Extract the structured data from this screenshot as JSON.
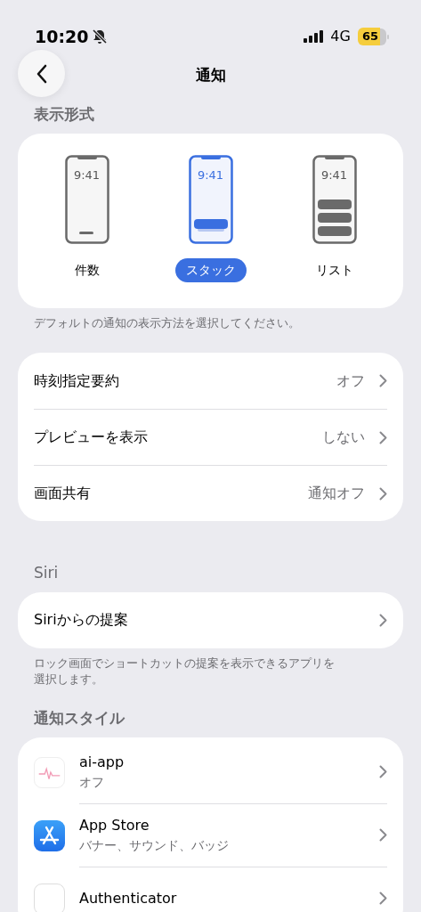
{
  "status_bar": {
    "time": "10:20",
    "network": "4G",
    "battery": "65"
  },
  "nav": {
    "title": "通知"
  },
  "display_style": {
    "header": "表示形式",
    "options": [
      {
        "label": "件数",
        "kind": "count",
        "time": "9:41",
        "selected": false
      },
      {
        "label": "スタック",
        "kind": "stack",
        "time": "9:41",
        "selected": true
      },
      {
        "label": "リスト",
        "kind": "list",
        "time": "9:41",
        "selected": false
      }
    ],
    "footer": "デフォルトの通知の表示方法を選択してください。"
  },
  "settings": [
    {
      "label": "時刻指定要約",
      "value": "オフ"
    },
    {
      "label": "プレビューを表示",
      "value": "しない"
    },
    {
      "label": "画面共有",
      "value": "通知オフ"
    }
  ],
  "siri": {
    "header": "Siri",
    "rows": [
      {
        "label": "Siriからの提案"
      }
    ],
    "footer": "ロック画面でショートカットの提案を表示できるアプリを選択します。"
  },
  "notification_style": {
    "header": "通知スタイル",
    "apps": [
      {
        "name": "ai-app",
        "detail": "オフ",
        "kind": "pulse"
      },
      {
        "name": "App Store",
        "detail": "バナー、サウンド、バッジ",
        "kind": "store"
      },
      {
        "name": "Authenticator",
        "kind": "plain"
      }
    ]
  }
}
